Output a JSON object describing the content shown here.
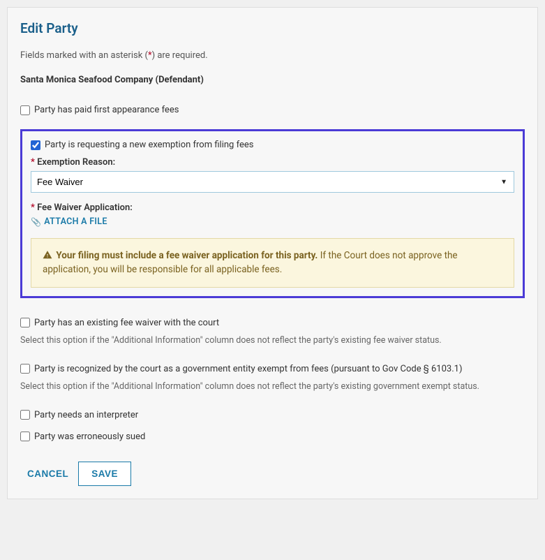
{
  "title": "Edit Party",
  "requiredNotePrefix": "Fields marked with an asterisk (",
  "requiredAsterisk": "*",
  "requiredNoteSuffix": ") are required.",
  "partyName": "Santa Monica Seafood Company (Defendant)",
  "checkboxes": {
    "paid_fees": "Party has paid first appearance fees",
    "requesting_exemption": "Party is requesting a new exemption from filing fees",
    "existing_waiver": "Party has an existing fee waiver with the court",
    "existing_waiver_help": "Select this option if the \"Additional Information\" column does not reflect the party's existing fee waiver status.",
    "gov_entity": "Party is recognized by the court as a government entity exempt from fees (pursuant to Gov Code § 6103.1)",
    "gov_entity_help": "Select this option if the \"Additional Information\" column does not reflect the party's existing government exempt status.",
    "interpreter": "Party needs an interpreter",
    "erroneously_sued": "Party was erroneously sued"
  },
  "exemption_reason": {
    "label": "Exemption Reason:",
    "value": "Fee Waiver",
    "asterisk": "*"
  },
  "fee_waiver_app": {
    "label": "Fee Waiver Application:",
    "asterisk": "*",
    "attach": "ATTACH A FILE"
  },
  "warning": {
    "bold": "Your filing must include a fee waiver application for this party.",
    "rest": " If the Court does not approve the application, you will be responsible for all applicable fees."
  },
  "actions": {
    "cancel": "CANCEL",
    "save": "SAVE"
  }
}
